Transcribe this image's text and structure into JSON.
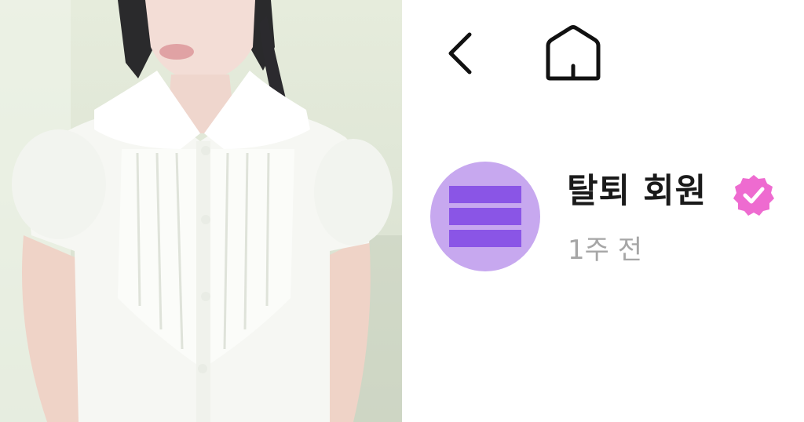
{
  "post": {
    "author_name": "탈퇴 회원",
    "timestamp": "1주 전",
    "verified": true
  },
  "nav": {
    "back_icon": "chevron-left-icon",
    "home_icon": "home-icon"
  },
  "avatar": {
    "icon": "deleted-member-avatar",
    "background_color": "#c7a8ef",
    "bar_color": "#8a55e6"
  },
  "badge": {
    "icon": "verified-check-icon",
    "color": "#ee6bd0"
  },
  "photo": {
    "description_icon": "photo-image"
  }
}
